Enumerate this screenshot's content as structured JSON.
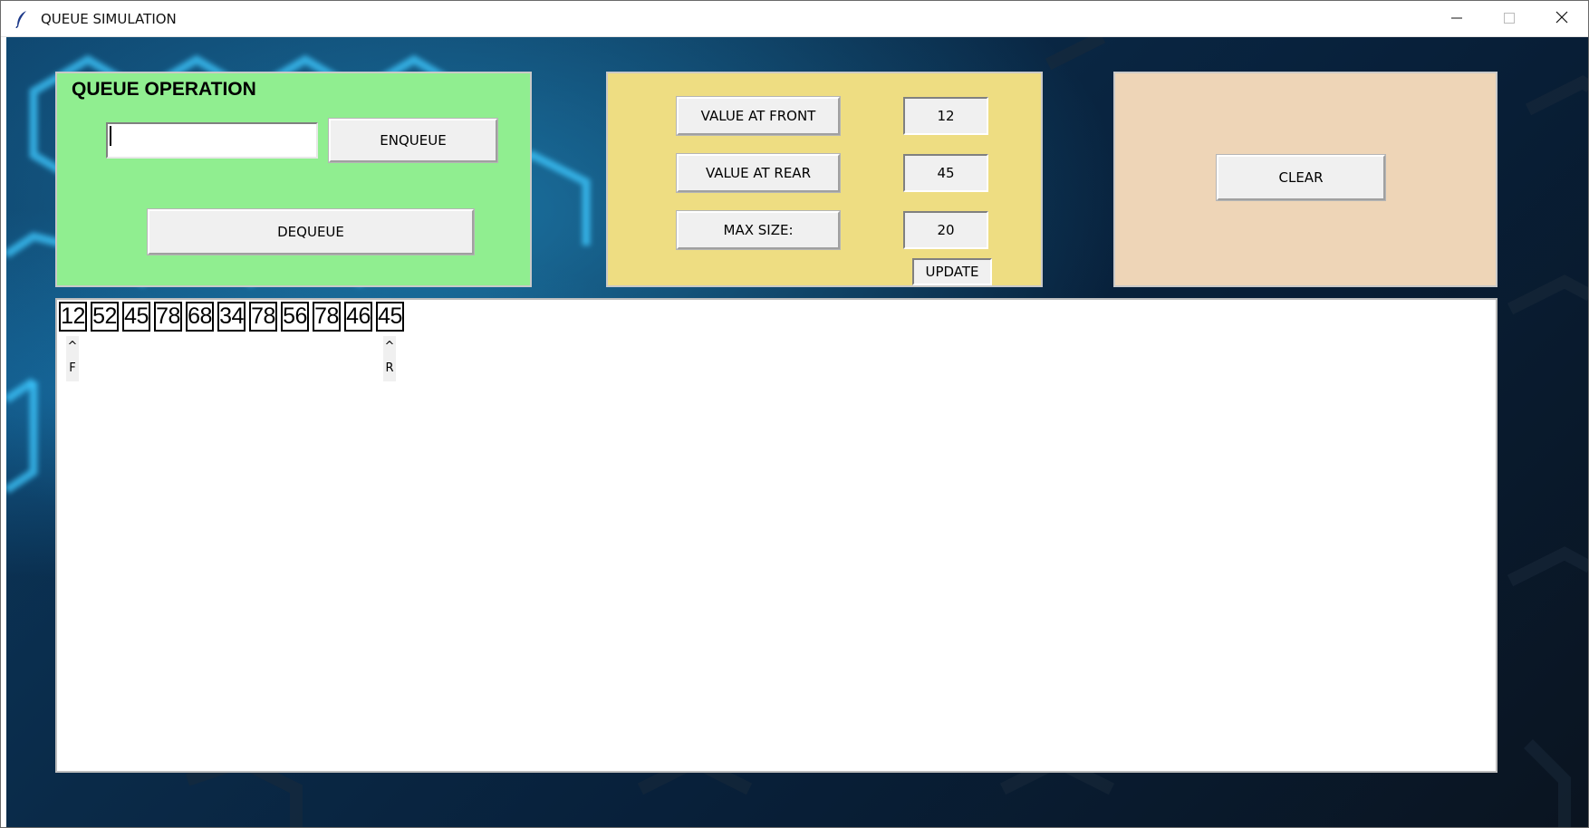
{
  "window": {
    "title": "QUEUE SIMULATION",
    "controls": {
      "minimize": "minimize",
      "maximize": "maximize",
      "close": "close"
    }
  },
  "operation_panel": {
    "title": "QUEUE OPERATION",
    "input_value": "",
    "enqueue_label": "ENQUEUE",
    "dequeue_label": "DEQUEUE",
    "color": "#90ee90"
  },
  "info_panel": {
    "front_label": "VALUE AT FRONT",
    "front_value": "12",
    "rear_label": "VALUE AT REAR",
    "rear_value": "45",
    "max_label": "MAX SIZE:",
    "max_value": "20",
    "update_label": "UPDATE",
    "color": "#eedd82"
  },
  "clear_panel": {
    "clear_label": "CLEAR",
    "color": "#eed5b7"
  },
  "queue": {
    "items": [
      "12",
      "52",
      "45",
      "78",
      "68",
      "34",
      "78",
      "56",
      "78",
      "46",
      "45"
    ],
    "front_caret": "^",
    "front_marker": "F",
    "rear_caret": "^",
    "rear_marker": "R"
  },
  "icons": {
    "app": "feather-icon",
    "minimize": "minimize-icon",
    "maximize": "maximize-icon",
    "close": "close-icon"
  }
}
